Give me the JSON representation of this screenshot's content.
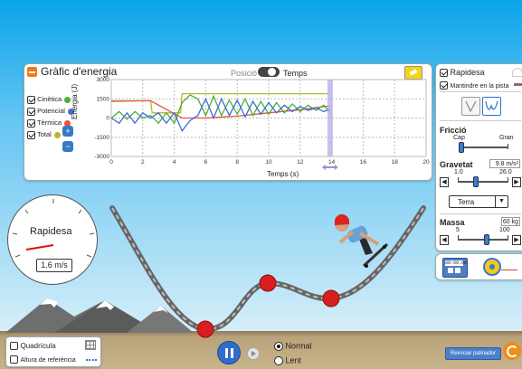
{
  "graph": {
    "title": "Gràfic d'energia",
    "toggle_left": "Posició",
    "toggle_right": "Temps",
    "ylabel": "Energia (J)",
    "xlabel": "Temps (s)",
    "y_ticks": [
      "3000",
      "1500",
      "0",
      "-1500",
      "-3000"
    ],
    "x_ticks": [
      "0",
      "2",
      "4",
      "6",
      "8",
      "10",
      "12",
      "14",
      "16",
      "18",
      "20"
    ],
    "legend": [
      {
        "label": "Cinètica",
        "color": "#4caf3c",
        "checked": true
      },
      {
        "label": "Potencial",
        "color": "#3b6fd4",
        "checked": true
      },
      {
        "label": "Tèrmica",
        "color": "#e8533a",
        "checked": true
      },
      {
        "label": "Total",
        "color": "#b6b82a",
        "checked": true
      }
    ]
  },
  "chart_data": {
    "type": "line",
    "title": "",
    "xlabel": "Temps (s)",
    "ylabel": "Energia (J)",
    "xlim": [
      0,
      20
    ],
    "ylim": [
      -3000,
      3000
    ],
    "grid": true,
    "cursor_time": 13.9,
    "series": [
      {
        "name": "Total",
        "color": "#b6b82a",
        "x": [
          0,
          2.5,
          2.6,
          4.4,
          4.5,
          13.9
        ],
        "y": [
          1350,
          1350,
          400,
          400,
          1900,
          1900
        ]
      },
      {
        "name": "Tèrmica",
        "color": "#e8533a",
        "x": [
          0,
          2.5,
          4.5,
          6,
          8,
          10,
          12,
          13.9
        ],
        "y": [
          1300,
          1350,
          0,
          0,
          150,
          400,
          650,
          950
        ]
      },
      {
        "name": "Cinètica",
        "color": "#4caf3c",
        "x": [
          0,
          0.5,
          1,
          1.5,
          2,
          2.5,
          3,
          3.5,
          4,
          4.5,
          5,
          5.5,
          6,
          6.5,
          7,
          7.5,
          8,
          8.5,
          9,
          9.5,
          10,
          10.5,
          11,
          11.5,
          12,
          12.5,
          13,
          13.5,
          13.9
        ],
        "y": [
          0,
          500,
          -100,
          500,
          0,
          200,
          -400,
          400,
          -400,
          1200,
          1800,
          1500,
          200,
          1700,
          200,
          1400,
          300,
          1500,
          200,
          1300,
          300,
          1200,
          400,
          1100,
          500,
          1000,
          600,
          1000,
          400
        ]
      },
      {
        "name": "Potencial",
        "color": "#3b6fd4",
        "x": [
          0,
          0.5,
          1,
          1.5,
          2,
          2.5,
          3,
          3.5,
          4,
          4.5,
          5,
          5.5,
          6,
          6.5,
          7,
          7.5,
          8,
          8.5,
          9,
          9.5,
          10,
          10.5,
          11,
          11.5,
          12,
          12.5,
          13,
          13.5,
          13.9
        ],
        "y": [
          0,
          -400,
          400,
          -400,
          400,
          0,
          400,
          -400,
          400,
          -1000,
          -200,
          200,
          1500,
          0,
          1500,
          200,
          1400,
          100,
          1300,
          300,
          1200,
          400,
          1000,
          500,
          900,
          600,
          800,
          500,
          700
        ]
      }
    ]
  },
  "controls": {
    "speed_label": "Rapidesa",
    "keep_track": "Mantindre en la pista",
    "friction": {
      "title": "Fricció",
      "min": "Cap",
      "max": "Gran",
      "value": 0.05
    },
    "gravity": {
      "title": "Gravetat",
      "value_text": "9.8 m/s²",
      "min": "1.0",
      "max": "26.0",
      "value": 9.8
    },
    "planet": "Terra",
    "mass": {
      "title": "Massa",
      "value_text": "60 kg",
      "min": "5",
      "max": "100",
      "value": 60
    },
    "stopwatch_text": "00:00.00",
    "speed_checked": true,
    "keep_checked": true
  },
  "gauge": {
    "title": "Rapidesa",
    "value": "1.6 m/s"
  },
  "bottom": {
    "grid_label": "Quadrícula",
    "ref_label": "Altura de referència",
    "speed_normal": "Normal",
    "speed_slow": "Lent",
    "reset_skater": "Reiniciar patinador"
  },
  "colors": {
    "sky": "#a8dcf6",
    "ground": "#b29a74",
    "accent": "#f07a1a",
    "track": "#8c8c8c"
  }
}
